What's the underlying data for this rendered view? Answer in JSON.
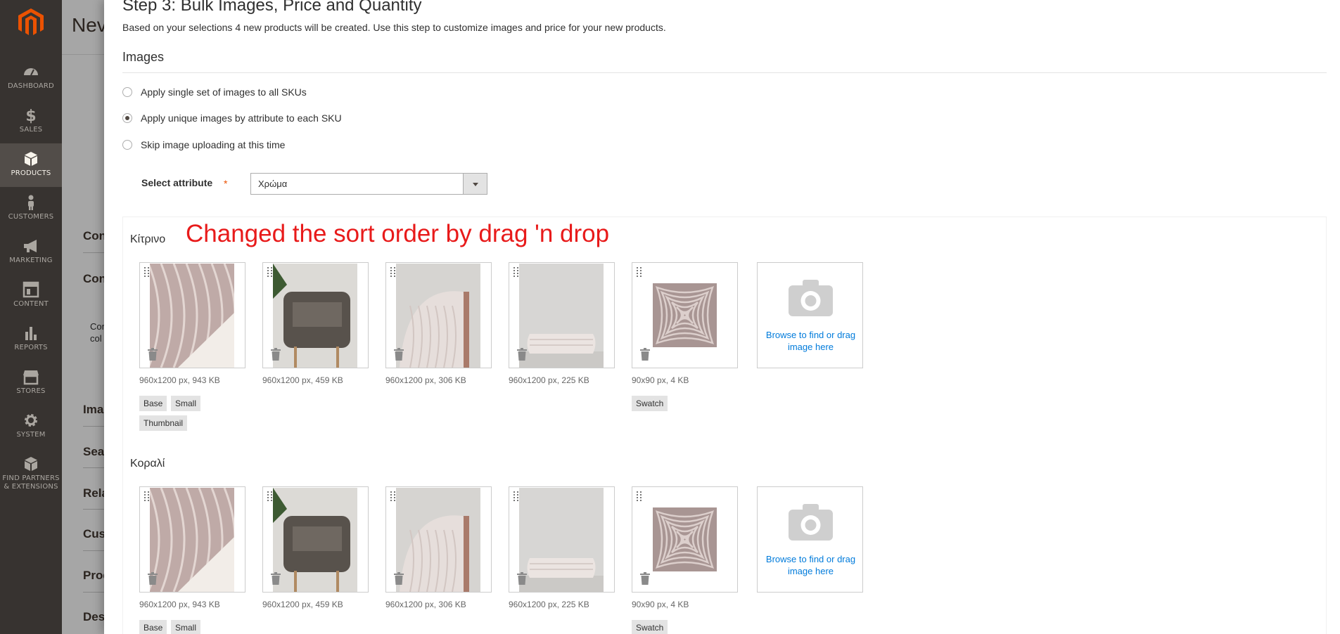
{
  "sidebar": {
    "items": [
      {
        "label": "DASHBOARD",
        "icon": "dashboard-icon"
      },
      {
        "label": "SALES",
        "icon": "dollar-icon"
      },
      {
        "label": "PRODUCTS",
        "icon": "cube-icon",
        "active": true
      },
      {
        "label": "CUSTOMERS",
        "icon": "person-icon"
      },
      {
        "label": "MARKETING",
        "icon": "megaphone-icon"
      },
      {
        "label": "CONTENT",
        "icon": "content-icon"
      },
      {
        "label": "REPORTS",
        "icon": "bar-chart-icon"
      },
      {
        "label": "STORES",
        "icon": "store-icon"
      },
      {
        "label": "SYSTEM",
        "icon": "gear-icon"
      },
      {
        "label": "FIND PARTNERS & EXTENSIONS",
        "label_line1": "FIND PARTNERS",
        "label_line2": "& EXTENSIONS",
        "icon": "extensions-icon"
      }
    ]
  },
  "background": {
    "title": "Nev",
    "sections": [
      "Con",
      "Con",
      "Ima",
      "Sea",
      "Rela",
      "Cus",
      "Prod",
      "Des"
    ],
    "small_text_line1": "Cor",
    "small_text_line2": "col"
  },
  "step": {
    "title": "Step 3: Bulk Images, Price and Quantity",
    "description": "Based on your selections 4 new products will be created. Use this step to customize images and price for your new products."
  },
  "images_section": {
    "title": "Images",
    "options": [
      {
        "label": "Apply single set of images to all SKUs",
        "checked": false
      },
      {
        "label": "Apply unique images by attribute to each SKU",
        "checked": true
      },
      {
        "label": "Skip image uploading at this time",
        "checked": false
      }
    ],
    "select_attribute_label": "Select attribute",
    "required_mark": "*",
    "select_attribute_value": "Χρώμα"
  },
  "annotation": "Changed the sort order by drag 'n drop",
  "groups": [
    {
      "label": "Κίτρινο",
      "images": [
        {
          "meta": "960x1200 px, 943 KB",
          "roles": [
            "Base",
            "Small",
            "Thumbnail"
          ]
        },
        {
          "meta": "960x1200 px, 459 KB",
          "roles": []
        },
        {
          "meta": "960x1200 px, 306 KB",
          "roles": []
        },
        {
          "meta": "960x1200 px, 225 KB",
          "roles": []
        },
        {
          "meta": "90x90 px, 4 KB",
          "roles": [
            "Swatch"
          ]
        }
      ],
      "uploader_text": "Browse to find or drag image here"
    },
    {
      "label": "Κοραλί",
      "images": [
        {
          "meta": "960x1200 px, 943 KB",
          "roles": [
            "Base",
            "Small"
          ]
        },
        {
          "meta": "960x1200 px, 459 KB",
          "roles": []
        },
        {
          "meta": "960x1200 px, 306 KB",
          "roles": []
        },
        {
          "meta": "960x1200 px, 225 KB",
          "roles": []
        },
        {
          "meta": "90x90 px, 4 KB",
          "roles": [
            "Swatch"
          ]
        }
      ],
      "uploader_text": "Browse to find or drag image here"
    }
  ],
  "colors": {
    "sidebar_bg": "#373330",
    "sidebar_active": "#524d49",
    "logo": "#eb5202",
    "required": "#eb5202",
    "link": "#007bdb",
    "annotation": "#e81a1a"
  }
}
